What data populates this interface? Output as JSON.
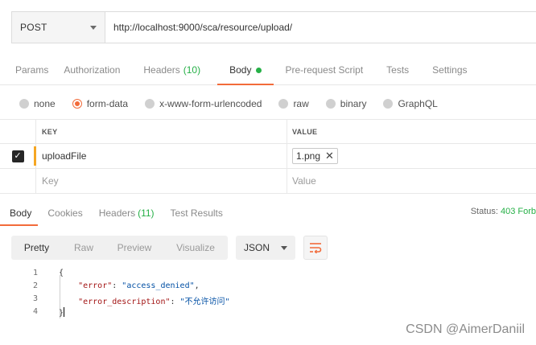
{
  "request": {
    "method": "POST",
    "url": "http://localhost:9000/sca/resource/upload/"
  },
  "tabs": [
    {
      "label": "Params"
    },
    {
      "label": "Authorization"
    },
    {
      "label": "Headers",
      "count": "(10)"
    },
    {
      "label": "Body"
    },
    {
      "label": "Pre-request Script"
    },
    {
      "label": "Tests"
    },
    {
      "label": "Settings"
    }
  ],
  "body_types": [
    {
      "label": "none",
      "selected": false
    },
    {
      "label": "form-data",
      "selected": true
    },
    {
      "label": "x-www-form-urlencoded",
      "selected": false
    },
    {
      "label": "raw",
      "selected": false
    },
    {
      "label": "binary",
      "selected": false
    },
    {
      "label": "GraphQL",
      "selected": false
    }
  ],
  "kv_table": {
    "key_header": "KEY",
    "value_header": "VALUE",
    "row": {
      "key": "uploadFile",
      "file": "1.png",
      "checked": true
    },
    "new_row": {
      "key_placeholder": "Key",
      "value_placeholder": "Value"
    }
  },
  "response": {
    "tabs": [
      {
        "label": "Body"
      },
      {
        "label": "Cookies"
      },
      {
        "label": "Headers",
        "count": "(11)"
      },
      {
        "label": "Test Results"
      }
    ],
    "status_label": "Status:",
    "status_code": "403 Forb",
    "views": [
      "Pretty",
      "Raw",
      "Preview",
      "Visualize"
    ],
    "format": "JSON",
    "lines": [
      {
        "n": "1",
        "text": "{"
      },
      {
        "n": "2",
        "key": "\"error\"",
        "value": "\"access_denied\"",
        "trail": ","
      },
      {
        "n": "3",
        "key": "\"error_description\"",
        "value": "\"不允许访问\"",
        "trail": ""
      },
      {
        "n": "4",
        "text": "}"
      }
    ]
  },
  "watermark": "CSDN @AimerDaniil",
  "colors": {
    "accent": "#f26b3a",
    "green": "#26b047",
    "marker": "#f5a623"
  }
}
